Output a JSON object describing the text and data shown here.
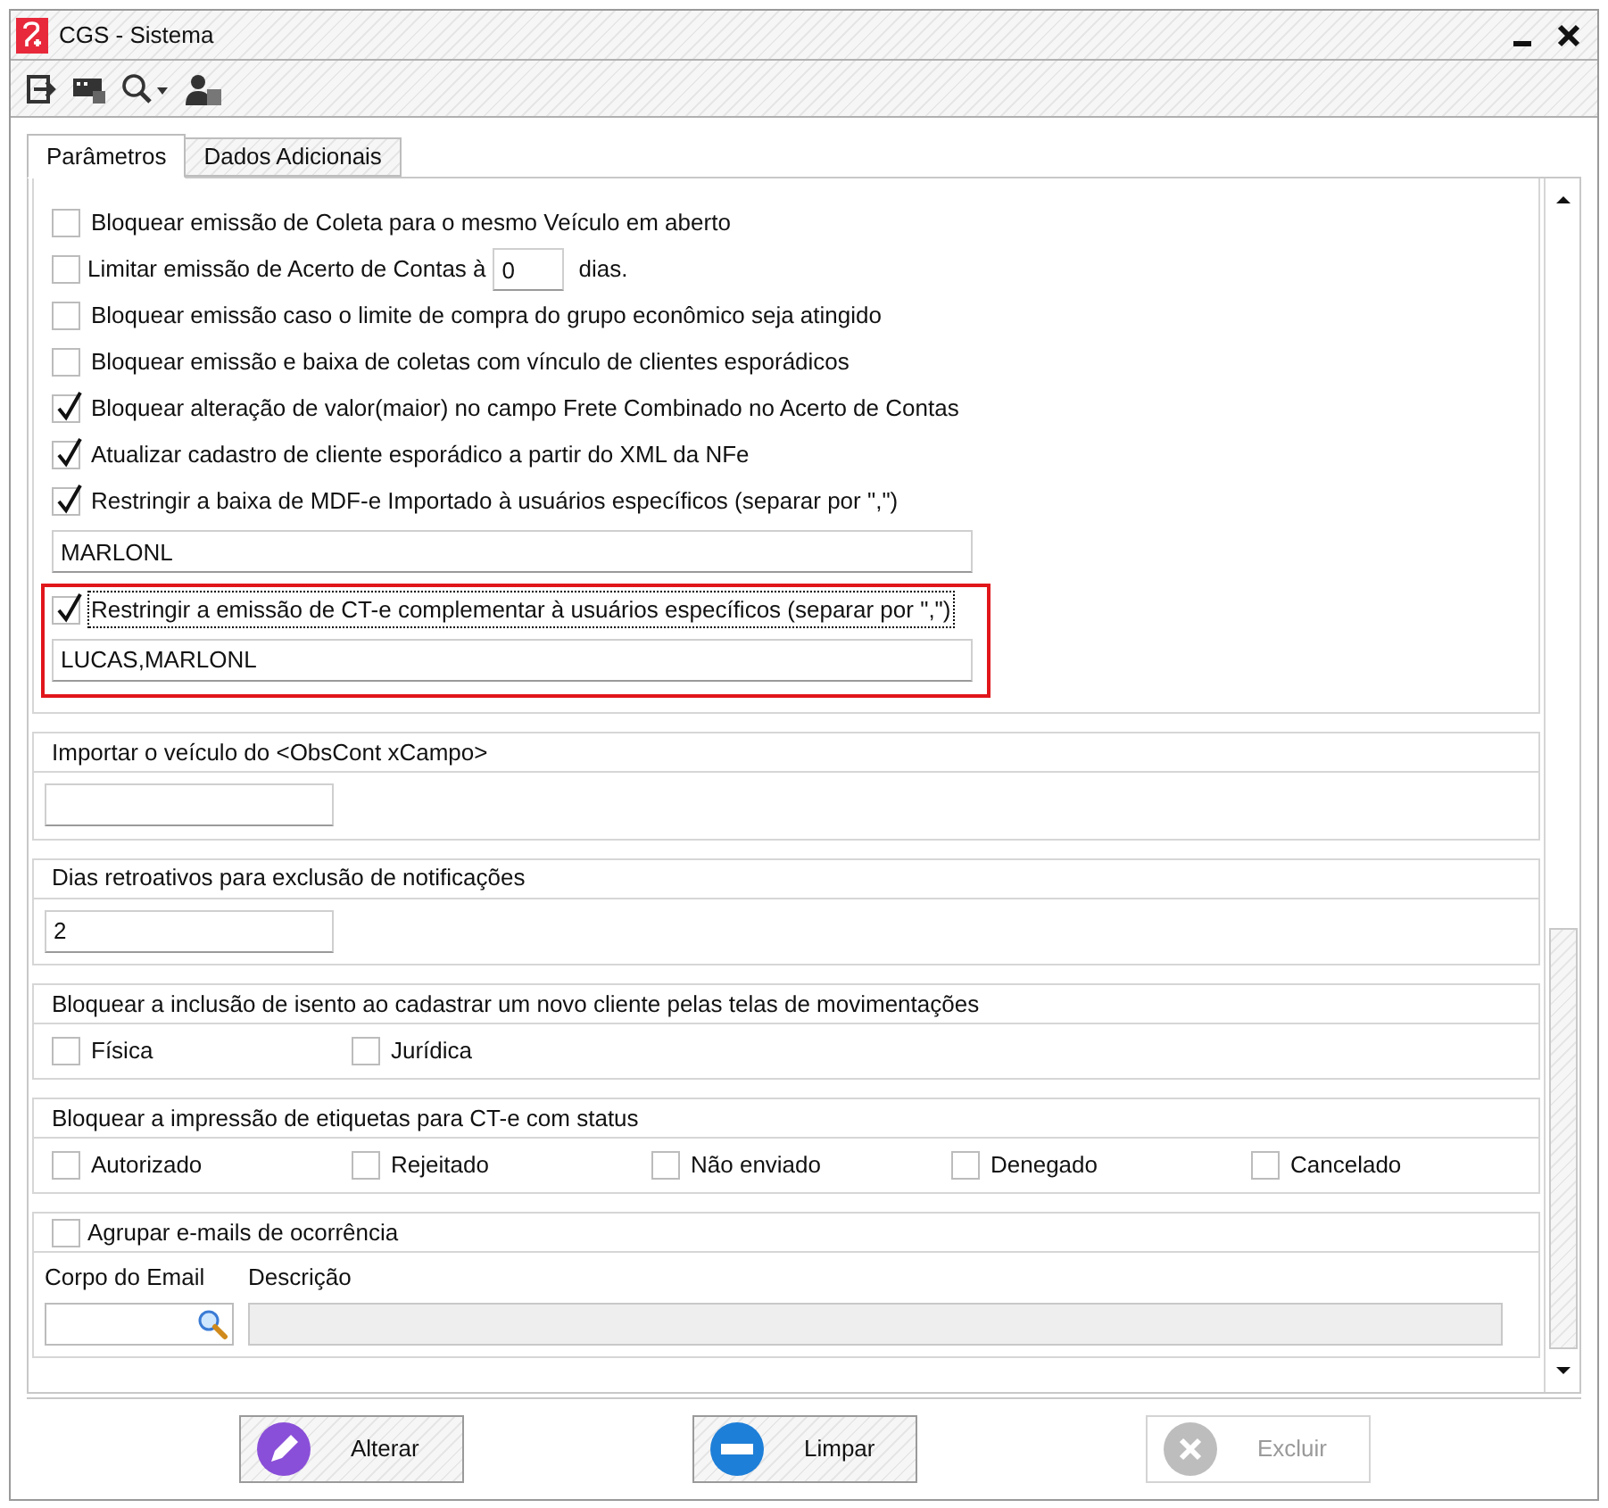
{
  "window": {
    "title": "CGS - Sistema"
  },
  "tabs": [
    {
      "label": "Parâmetros",
      "selected": true
    },
    {
      "label": "Dados Adicionais",
      "selected": false
    }
  ],
  "options": [
    {
      "kind": "checkbox",
      "label": "Bloquear emissão de Coleta para o mesmo Veículo em aberto",
      "checked": false
    },
    {
      "kind": "days",
      "label": "Limitar emissão de Acerto de Contas à",
      "value": "0",
      "suffix": "dias.",
      "checked": false
    },
    {
      "kind": "checkbox",
      "label": "Bloquear emissão caso o limite de compra do grupo econômico seja atingido",
      "checked": false
    },
    {
      "kind": "checkbox",
      "label": "Bloquear emissão e baixa de coletas com vínculo de clientes esporádicos",
      "checked": false
    },
    {
      "kind": "checkbox",
      "label": "Bloquear alteração de valor(maior) no campo Frete Combinado no Acerto de Contas",
      "checked": true
    },
    {
      "kind": "checkbox",
      "label": "Atualizar cadastro de cliente esporádico a partir do XML da NFe",
      "checked": true
    },
    {
      "kind": "checkbox",
      "label": "Restringir a baixa de MDF-e Importado à usuários específicos (separar por \",\")",
      "checked": true
    },
    {
      "kind": "field",
      "value": "MARLONL"
    },
    {
      "kind": "highlight",
      "children": [
        {
          "kind": "checkbox",
          "label": "Restringir a emissão de CT-e complementar à usuários específicos (separar por \",\")",
          "checked": true,
          "focused": true
        },
        {
          "kind": "field",
          "value": "LUCAS,MARLONL"
        }
      ]
    }
  ],
  "sections": [
    {
      "kind": "field",
      "title": "Importar o veículo do <ObsCont xCampo>"
    },
    {
      "kind": "field",
      "title": "Dias retroativos para exclusão de notificações",
      "value": "2"
    },
    {
      "kind": "checks",
      "title": "Bloquear a inclusão de isento ao cadastrar um novo cliente pelas telas de movimentações",
      "options": [
        {
          "label": "Física",
          "checked": false
        },
        {
          "label": "Jurídica",
          "checked": false
        }
      ]
    },
    {
      "kind": "checks",
      "title": "Bloquear a impressão de etiquetas para CT-e com status",
      "options": [
        {
          "label": "Autorizado",
          "checked": false
        },
        {
          "label": "Rejeitado",
          "checked": false
        },
        {
          "label": "Não enviado",
          "checked": false
        },
        {
          "label": "Denegado",
          "checked": false
        },
        {
          "label": "Cancelado",
          "checked": false
        }
      ]
    },
    {
      "kind": "email",
      "title": "Agrupar e-mails de ocorrência",
      "checked": false,
      "fields": [
        {
          "label": "Corpo do Email",
          "disabled": false
        },
        {
          "label": "Descrição",
          "disabled": true
        }
      ]
    }
  ],
  "buttons": [
    {
      "kind": "edit",
      "label": "Alterar",
      "disabled": false
    },
    {
      "kind": "clear",
      "label": "Limpar",
      "disabled": false
    },
    {
      "kind": "delete",
      "label": "Excluir",
      "disabled": true
    }
  ]
}
